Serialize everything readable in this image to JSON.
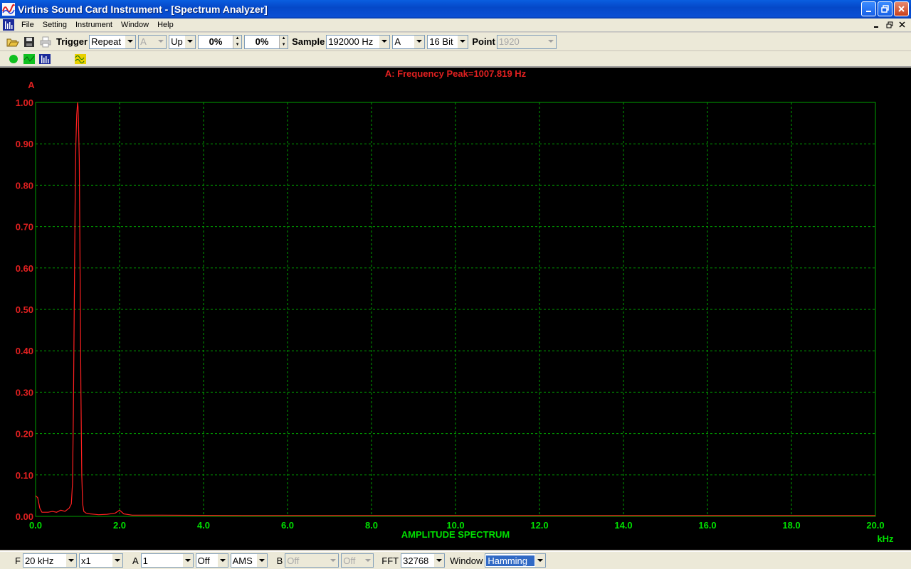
{
  "window": {
    "title": "Virtins Sound Card Instrument - [Spectrum Analyzer]"
  },
  "menu": [
    "File",
    "Setting",
    "Instrument",
    "Window",
    "Help"
  ],
  "toolbar": {
    "trigger_label": "Trigger",
    "trigger_mode": "Repeat",
    "trigger_channel": "A",
    "trigger_edge": "Up",
    "trigger_level": "0%",
    "trigger_delay": "0%",
    "sample_label": "Sample",
    "sample_rate": "192000 Hz",
    "channel": "A",
    "bits": "16 Bit",
    "point_label": "Point",
    "points": "1920"
  },
  "plot": {
    "peak_annotation": "A: Frequency Peak=1007.819 Hz",
    "channel_label": "A",
    "x_title": "AMPLITUDE SPECTRUM",
    "x_unit": "kHz",
    "colors": {
      "trace": "#ff2020",
      "grid": "#00a000",
      "x_labels": "#00e000",
      "y_labels": "#e02020"
    }
  },
  "chart_data": {
    "type": "line",
    "title": "A: Frequency Peak=1007.819 Hz",
    "xlabel": "AMPLITUDE SPECTRUM",
    "ylabel": "A",
    "x_unit": "kHz",
    "xlim": [
      0.0,
      20.0
    ],
    "ylim": [
      0.0,
      1.0
    ],
    "x_ticks": [
      "0.0",
      "2.0",
      "4.0",
      "6.0",
      "8.0",
      "10.0",
      "12.0",
      "14.0",
      "16.0",
      "18.0",
      "20.0"
    ],
    "y_ticks": [
      "1.00",
      "0.90",
      "0.80",
      "0.70",
      "0.60",
      "0.50",
      "0.40",
      "0.30",
      "0.20",
      "0.10",
      "0.00"
    ],
    "grid": true,
    "series": [
      {
        "x": [
          0.0,
          0.05,
          0.1,
          0.15,
          0.2,
          0.3,
          0.4,
          0.5,
          0.6,
          0.7,
          0.8,
          0.85,
          0.88,
          0.9,
          0.92,
          0.94,
          0.96,
          0.98,
          1.0,
          1.01,
          1.02,
          1.04,
          1.06,
          1.08,
          1.1,
          1.12,
          1.15,
          1.2,
          1.3,
          1.5,
          1.7,
          1.9,
          2.0,
          2.1,
          2.3,
          3.0,
          5.0,
          8.0,
          10.0,
          12.0,
          15.0,
          18.0,
          19.5,
          20.0
        ],
        "y": [
          0.05,
          0.045,
          0.02,
          0.01,
          0.01,
          0.01,
          0.012,
          0.01,
          0.015,
          0.012,
          0.02,
          0.03,
          0.08,
          0.25,
          0.5,
          0.75,
          0.9,
          0.97,
          1.0,
          0.99,
          0.96,
          0.86,
          0.6,
          0.3,
          0.1,
          0.03,
          0.012,
          0.008,
          0.006,
          0.004,
          0.005,
          0.008,
          0.015,
          0.006,
          0.003,
          0.003,
          0.002,
          0.002,
          0.002,
          0.002,
          0.002,
          0.002,
          0.002,
          0.002
        ]
      }
    ]
  },
  "bottombar": {
    "f_label": "F",
    "f_range": "20 kHz",
    "f_mult": "x1",
    "a_label": "A",
    "a_value": "1",
    "a_mode": "Off",
    "a_type": "AMS",
    "b_label": "B",
    "b_value": "Off",
    "b_mode": "Off",
    "fft_label": "FFT",
    "fft_size": "32768",
    "window_label": "Window",
    "window_type": "Hamming"
  }
}
